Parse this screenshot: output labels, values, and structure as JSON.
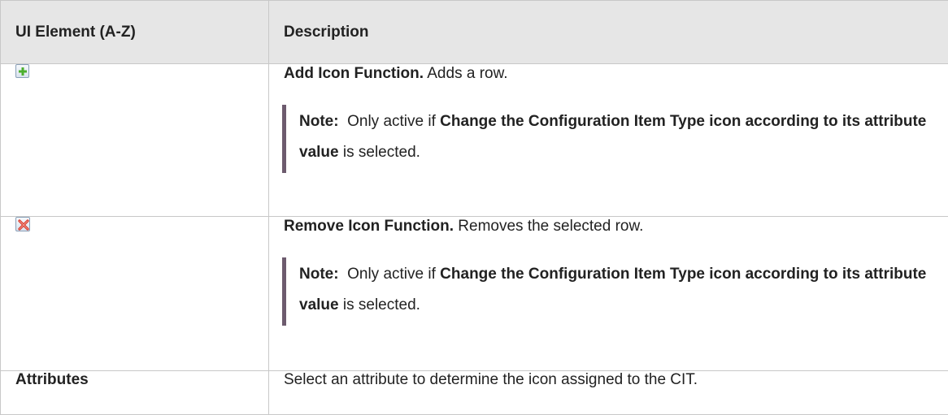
{
  "table": {
    "header": {
      "col1": "UI Element (A-Z)",
      "col2": "Description"
    },
    "rows": [
      {
        "element_icon": "add-plus-icon",
        "title": "Add Icon Function.",
        "text": " Adds a row.",
        "note_label": "Note:",
        "note_pre": "  Only active if ",
        "note_bold": "Change the Configuration Item Type icon according to its attribute value",
        "note_post": " is selected."
      },
      {
        "element_icon": "remove-x-icon",
        "title": "Remove Icon Function.",
        "text": " Removes the selected row.",
        "note_label": "Note:",
        "note_pre": "  Only active if ",
        "note_bold": "Change the Configuration Item Type icon according to its attribute value",
        "note_post": " is selected."
      },
      {
        "element": "Attributes",
        "text": "Select an attribute to determine the icon assigned to the CIT."
      }
    ]
  },
  "colors": {
    "header_bg": "#e6e6e6",
    "border": "#c8c8c8",
    "note_bar": "#6d5b6e",
    "add_icon": "#4caf2e",
    "remove_icon": "#d9382a"
  }
}
